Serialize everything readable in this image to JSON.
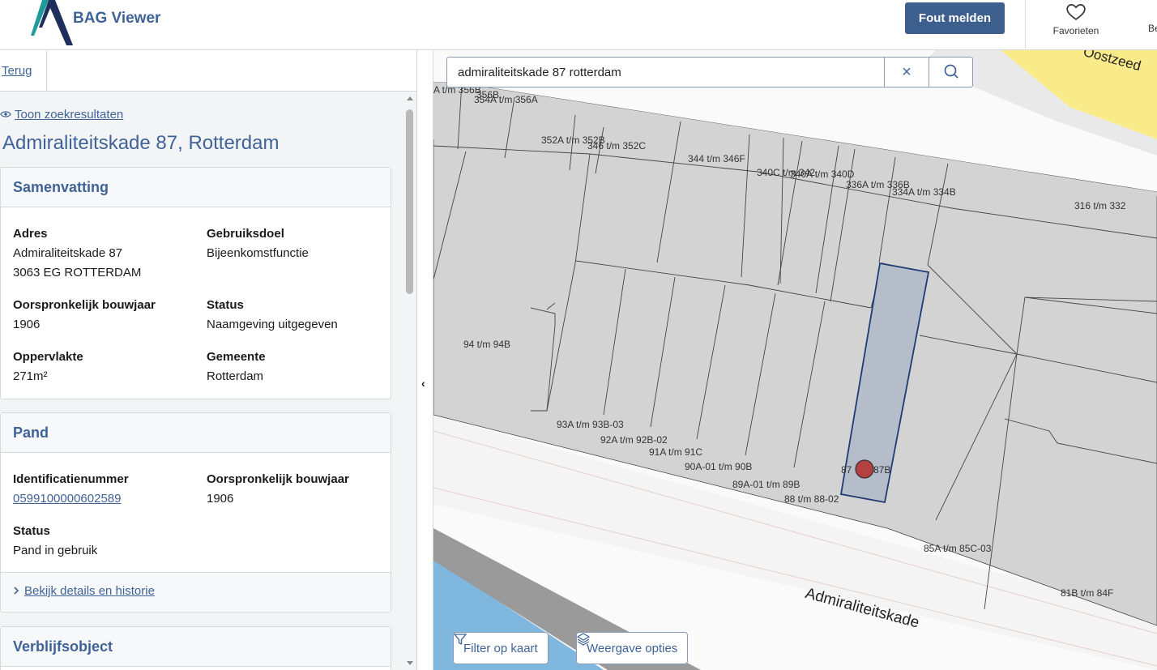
{
  "header": {
    "app_title": "BAG Viewer",
    "report_button": "Fout melden",
    "favorites_label": "Favorieten",
    "clipped_label": "Be"
  },
  "left": {
    "back_label": "Terug",
    "show_results": "Toon zoekresultaten",
    "title": "Admiraliteitskade 87, Rotterdam",
    "summary": {
      "heading": "Samenvatting",
      "adres_label": "Adres",
      "adres_line1": "Admiraliteitskade 87",
      "adres_line2": "3063 EG  ROTTERDAM",
      "gebruiksdoel_label": "Gebruiksdoel",
      "gebruiksdoel_value": "Bijeenkomstfunctie",
      "bouwjaar_label": "Oorspronkelijk bouwjaar",
      "bouwjaar_value": "1906",
      "status_label": "Status",
      "status_value": "Naamgeving uitgegeven",
      "oppervlakte_label": "Oppervlakte",
      "oppervlakte_value": "271m²",
      "gemeente_label": "Gemeente",
      "gemeente_value": "Rotterdam"
    },
    "pand": {
      "heading": "Pand",
      "id_label": "Identificatienummer",
      "id_value": "0599100000602589",
      "bouwjaar_label": "Oorspronkelijk bouwjaar",
      "bouwjaar_value": "1906",
      "status_label": "Status",
      "status_value": "Pand in gebruik",
      "details_link": "Bekijk details en historie"
    },
    "verblijfsobject": {
      "heading": "Verblijfsobject"
    }
  },
  "map": {
    "search_value": "admiraliteitskade 87 rotterdam",
    "clear_symbol": "×",
    "street_label": "Admiraliteitskade",
    "ostzeedijk_label": "Oostzeed",
    "filter_button": "Filter op kaart",
    "view_options_button": "Weergave opties",
    "labels": {
      "l356b": "A t/m 356B",
      "l356b2": "356B",
      "l354a": "354A t/m 356A",
      "l352a": "352A t/m 352B",
      "l346": "346 t/m 352C",
      "l344": "344 t/m 346F",
      "l340c": "340C t/m 342",
      "l340a": "340A t/m 340D",
      "l336a": "336A t/m 336B",
      "l334a": "334A t/m 334B",
      "l316": "316 t/m 332",
      "l94": "94 t/m 94B",
      "l93a": "93A t/m 93B-03",
      "l92a": "92A t/m 92B-02",
      "l91a": "91A t/m 91C",
      "l90a": "90A-01 t/m 90B",
      "l89a": "89A-01 t/m 89B",
      "l88": "88 t/m 88-02",
      "l87": "87",
      "l87b": "87B",
      "l85a": "85A t/m 85C-03",
      "l81b": "81B t/m 84F"
    }
  }
}
